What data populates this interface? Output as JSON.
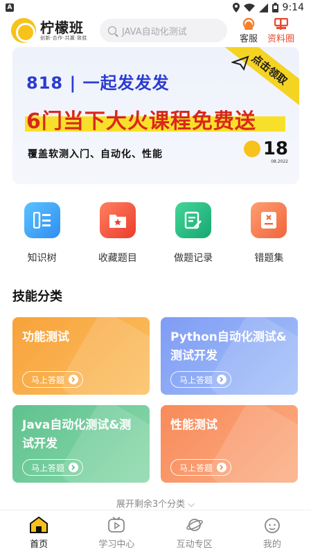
{
  "status_bar": {
    "time": "9:14"
  },
  "header": {
    "logo_title": "柠檬班",
    "logo_subtitle": "创新·合作·共赢·致胜",
    "search_placeholder": "JAVA自动化测试",
    "service_label": "客服",
    "materials_label": "资料圈"
  },
  "banner": {
    "line1": "818 | 一起发发发",
    "line2": "6门当下大火课程免费送",
    "line3": "覆盖软测入门、自动化、性能",
    "corner": "点击领取",
    "badge_number": "18",
    "badge_date": "08.2022"
  },
  "quick_entries": [
    {
      "label": "知识树",
      "icon": "tree-icon",
      "color": "#3ea6f5"
    },
    {
      "label": "收藏题目",
      "icon": "star-folder-icon",
      "color": "#f2583e"
    },
    {
      "label": "做题记录",
      "icon": "edit-note-icon",
      "color": "#2fbf86"
    },
    {
      "label": "错题集",
      "icon": "wrong-note-icon",
      "color": "#f57b4f"
    }
  ],
  "skills": {
    "title": "技能分类",
    "cards": [
      {
        "title": "功能测试",
        "button": "马上答题"
      },
      {
        "title": "Python自动化测试&测试开发",
        "button": "马上答题"
      },
      {
        "title": "Java自动化测试&测试开发",
        "button": "马上答题"
      },
      {
        "title": "性能测试",
        "button": "马上答题"
      }
    ],
    "expand_label": "展开剩余3个分类"
  },
  "tabbar": [
    {
      "label": "首页",
      "icon": "home-icon",
      "active": true
    },
    {
      "label": "学习中心",
      "icon": "play-tv-icon",
      "active": false
    },
    {
      "label": "互动专区",
      "icon": "planet-icon",
      "active": false
    },
    {
      "label": "我的",
      "icon": "profile-face-icon",
      "active": false
    }
  ],
  "colors": {
    "accent": "#f7c21a",
    "brand_red": "#e84a2e"
  }
}
